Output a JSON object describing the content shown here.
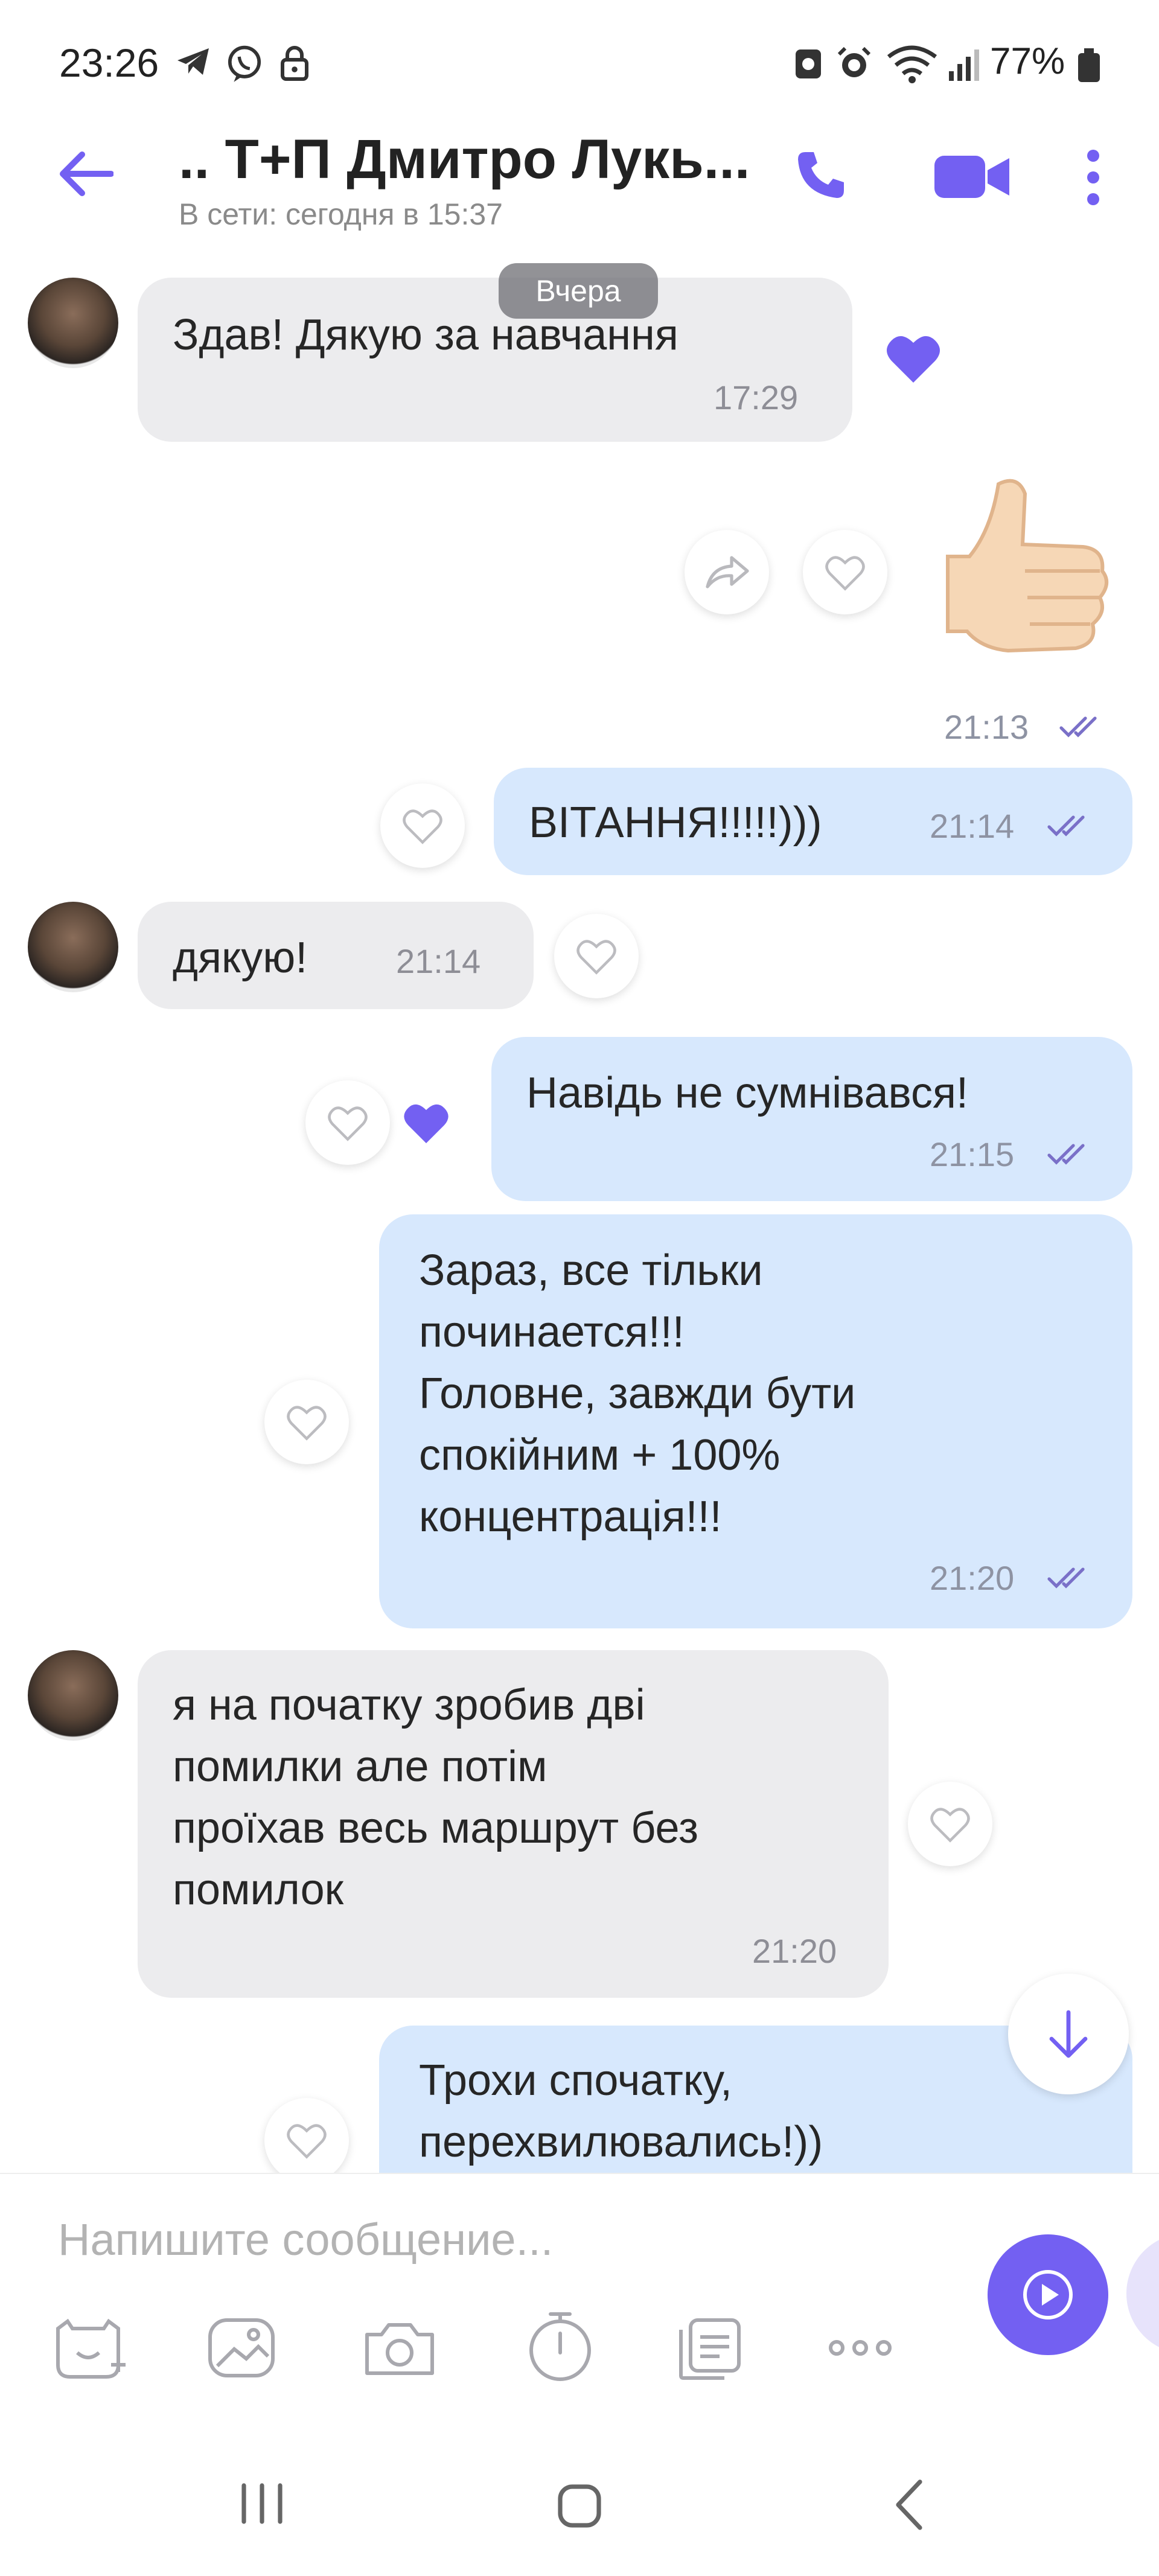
{
  "status_bar": {
    "time": "23:26",
    "battery": "77%"
  },
  "header": {
    "contact_name": ".. Т+П Дмитро Лукь...",
    "status": "В сети: сегодня в 15:37"
  },
  "date_divider": "Вчера",
  "messages": [
    {
      "direction": "in",
      "text": "Здав! Дякую за навчання",
      "time": "17:29",
      "reaction": "liked"
    },
    {
      "direction": "out",
      "type": "sticker",
      "sticker": "thumbs-up",
      "time": "21:13"
    },
    {
      "direction": "out",
      "text": "ВІТАННЯ!!!!!)))",
      "time": "21:14"
    },
    {
      "direction": "in",
      "text": "дякую!",
      "time": "21:14"
    },
    {
      "direction": "out",
      "text": "Навідь не  сумнівався!",
      "time": "21:15",
      "reaction": "liked"
    },
    {
      "direction": "out",
      "text": "Зараз, все тільки\nпочинается!!!\nГоловне, завжди бути\nспокійним + 100%\nконцентрація!!!",
      "time": "21:20"
    },
    {
      "direction": "in",
      "text": "я на початку зробив дві\nпомилки але потім\nпроїхав весь маршрут без\nпомилок",
      "time": "21:20"
    },
    {
      "direction": "out",
      "text": "Трохи спочатку,\nперехвилювались!))",
      "time": ""
    }
  ],
  "composer": {
    "placeholder": "Напишите сообщение..."
  },
  "colors": {
    "accent": "#7360f2",
    "outgoing_bubble": "#d7e8fd",
    "incoming_bubble": "#ececee"
  }
}
